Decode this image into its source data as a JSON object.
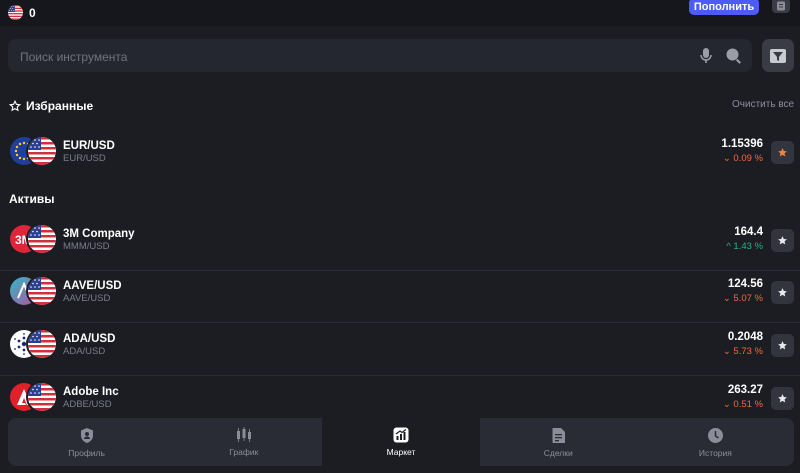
{
  "header": {
    "balance": "0",
    "deposit_label": "Пополнить"
  },
  "search": {
    "placeholder": "Поиск инструмента"
  },
  "favorites": {
    "title": "Избранные",
    "clear_label": "Очистить все",
    "items": [
      {
        "name": "EUR/USD",
        "sub": "EUR/USD",
        "price": "1.15396",
        "change": "⌄ 0.09 %",
        "direction": "down",
        "starred": true,
        "asset_icon": "eu-flag-icon"
      }
    ]
  },
  "assets": {
    "title": "Активы",
    "items": [
      {
        "name": "3M Company",
        "sub": "MMM/USD",
        "price": "164.4",
        "change": "^ 1.43 %",
        "direction": "up",
        "starred": false,
        "asset_icon": "3m-logo-icon"
      },
      {
        "name": "AAVE/USD",
        "sub": "AAVE/USD",
        "price": "124.56",
        "change": "⌄ 5.07 %",
        "direction": "down",
        "starred": false,
        "asset_icon": "aave-logo-icon"
      },
      {
        "name": "ADA/USD",
        "sub": "ADA/USD",
        "price": "0.2048",
        "change": "⌄ 5.73 %",
        "direction": "down",
        "starred": false,
        "asset_icon": "cardano-logo-icon"
      },
      {
        "name": "Adobe Inc",
        "sub": "ADBE/USD",
        "price": "263.27",
        "change": "⌄ 0.51 %",
        "direction": "down",
        "starred": false,
        "asset_icon": "adobe-logo-icon"
      }
    ]
  },
  "nav": {
    "items": [
      {
        "label": "Профиль",
        "icon": "profile-shield-icon",
        "active": false
      },
      {
        "label": "График",
        "icon": "candlestick-icon",
        "active": false
      },
      {
        "label": "Маркет",
        "icon": "market-chart-icon",
        "active": true
      },
      {
        "label": "Сделки",
        "icon": "trades-doc-icon",
        "active": false
      },
      {
        "label": "История",
        "icon": "history-clock-icon",
        "active": false
      }
    ]
  },
  "colors": {
    "accent": "#4d5bf9",
    "negative": "#f26b3a",
    "positive": "#28b383",
    "star_active": "#f0833a",
    "background": "#1c1d23"
  }
}
